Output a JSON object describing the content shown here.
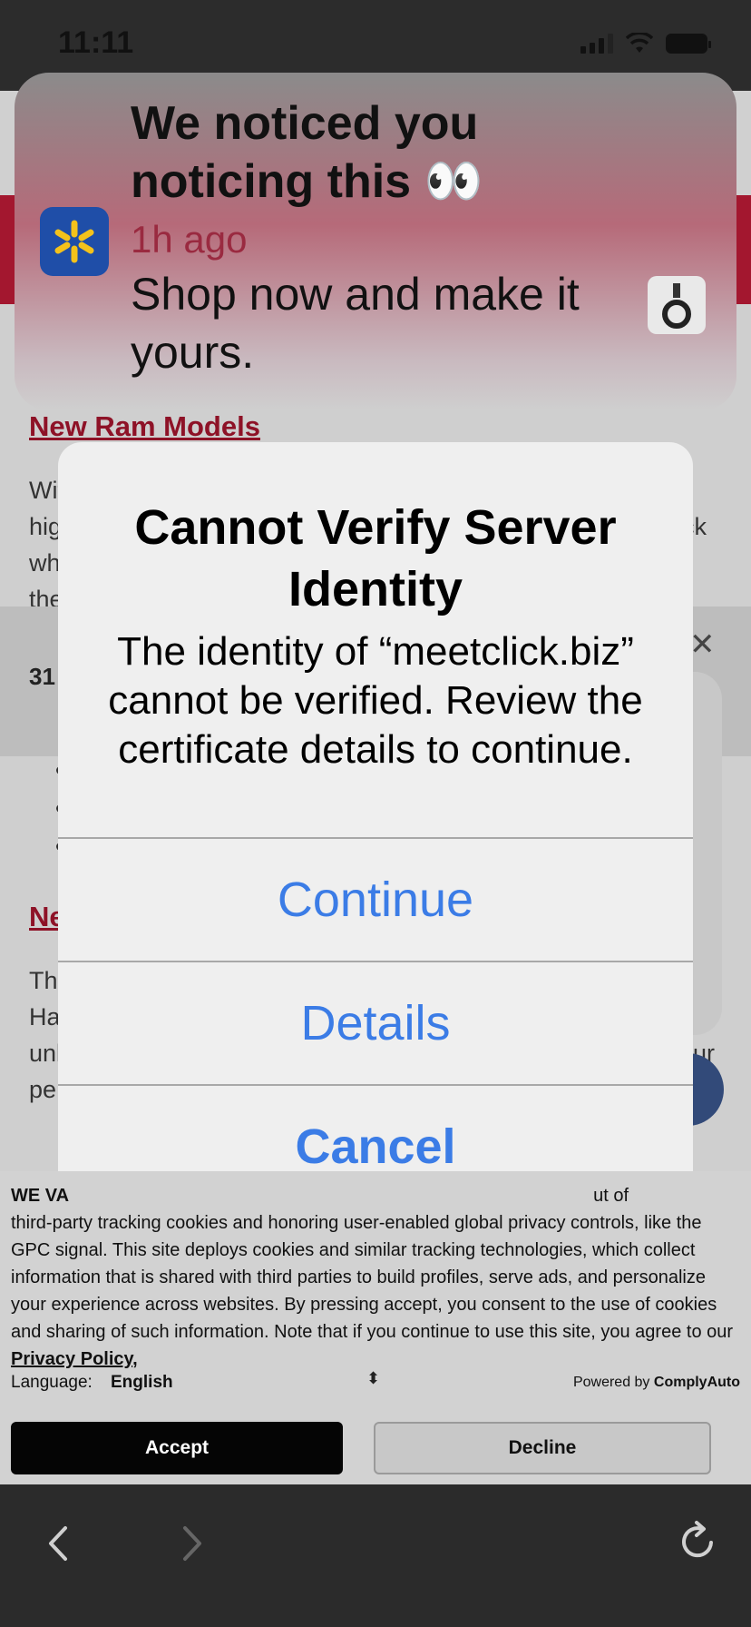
{
  "status_bar": {
    "time": "11:11"
  },
  "notification": {
    "title": "We noticed you noticing this 👀",
    "time": "1h ago",
    "body": "Shop now and make it yours."
  },
  "page": {
    "heading_1": "New Ram Models",
    "text_fragments": [
      "Wit",
      "hig",
      "wh",
      "the"
    ],
    "right_fragment": "ck",
    "band_text": "31",
    "heading_2": "Ne",
    "text_fragments_2": [
      "The",
      "Ha",
      "unl",
      "pe"
    ],
    "right_fragment_2": "ur"
  },
  "alert": {
    "title": "Cannot Verify Server Identity",
    "message": "The identity of “meetclick.biz” cannot be verified. Review the certificate details to continue.",
    "continue_label": "Continue",
    "details_label": "Details",
    "cancel_label": "Cancel"
  },
  "cookie_banner": {
    "lead": "WE VA",
    "lead_tail": "ut of",
    "text": "third-party tracking cookies and honoring user-enabled global privacy controls, like the GPC signal. This site deploys cookies and similar tracking technologies, which collect information that is shared with third parties to build profiles, serve ads, and personalize your experience across websites. By pressing accept, you consent to the use of cookies and sharing of such information. Note that if you continue to use this site, you agree to our",
    "privacy_link": "Privacy Policy",
    "language_label": "Language:",
    "language_value": "English",
    "powered_prefix": "Powered by",
    "powered_brand": "ComplyAuto",
    "accept_label": "Accept",
    "decline_label": "Decline"
  },
  "colors": {
    "accent_blue": "#3b7ce6",
    "brand_red": "#a3172f"
  }
}
